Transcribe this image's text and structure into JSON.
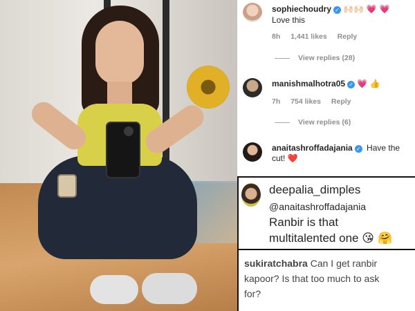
{
  "comments": [
    {
      "username": "sophiechoudry",
      "badge_emojis": "🙌🏻🙌🏻 💗 💗",
      "text": "Love this",
      "time": "8h",
      "likes": "1,441 likes",
      "reply": "Reply",
      "view_replies": "View replies (28)"
    },
    {
      "username": "manishmalhotra05",
      "badge_emojis": "💗 👍",
      "time": "7h",
      "likes": "754 likes",
      "reply": "Reply",
      "view_replies": "View replies (6)"
    },
    {
      "username": "anaitashroffadajania",
      "text": "Have the",
      "text2": "cut!",
      "heart": "❤️"
    },
    {
      "username": "deepalia_dimples",
      "mention": "@anaitashroffadajania",
      "line1": "Ranbir is that",
      "line2": "multitalented one",
      "emojis": "😘 🤗"
    },
    {
      "username": "sukiratchabra",
      "text1": "Can I get ranbir",
      "text2": "kapoor? Is that too much to ask",
      "text3": "for?"
    }
  ],
  "colors": {
    "verified": "#3897f0",
    "meta_gray": "#8e8e8e"
  },
  "icons": [
    "verified-badge-icon",
    "heart-icon"
  ]
}
